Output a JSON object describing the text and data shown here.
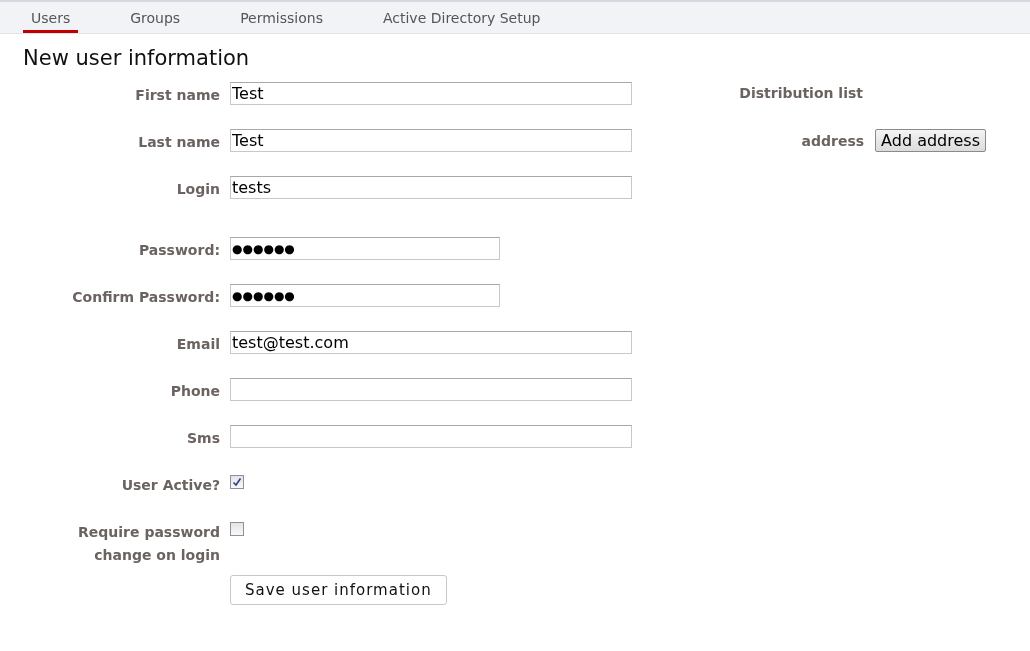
{
  "tabs": [
    {
      "label": "Users",
      "selected": true
    },
    {
      "label": "Groups",
      "selected": false
    },
    {
      "label": "Permissions",
      "selected": false
    },
    {
      "label": "Active Directory Setup",
      "selected": false
    }
  ],
  "heading": "New user information",
  "fields": [
    {
      "kind": "text",
      "label": "First name",
      "value": "Test"
    },
    {
      "kind": "text",
      "label": "Last name",
      "value": "Test"
    },
    {
      "kind": "text",
      "label": "Login",
      "value": "tests"
    },
    {
      "kind": "password",
      "label": "Password:",
      "value": "●●●●●●"
    },
    {
      "kind": "password",
      "label": "Confirm Password:",
      "value": "●●●●●●"
    },
    {
      "kind": "text",
      "label": "Email",
      "value": "test@test.com"
    },
    {
      "kind": "text",
      "label": "Phone"
    },
    {
      "kind": "text",
      "label": "Sms"
    },
    {
      "kind": "checkbox",
      "label": "User Active?",
      "checked": true
    },
    {
      "kind": "checkbox",
      "label": "Require password change on login",
      "checked": false
    }
  ],
  "save_button": "Save user information",
  "distribution": {
    "title": "Distribution list",
    "address_label": "address",
    "add_button": "Add address"
  }
}
